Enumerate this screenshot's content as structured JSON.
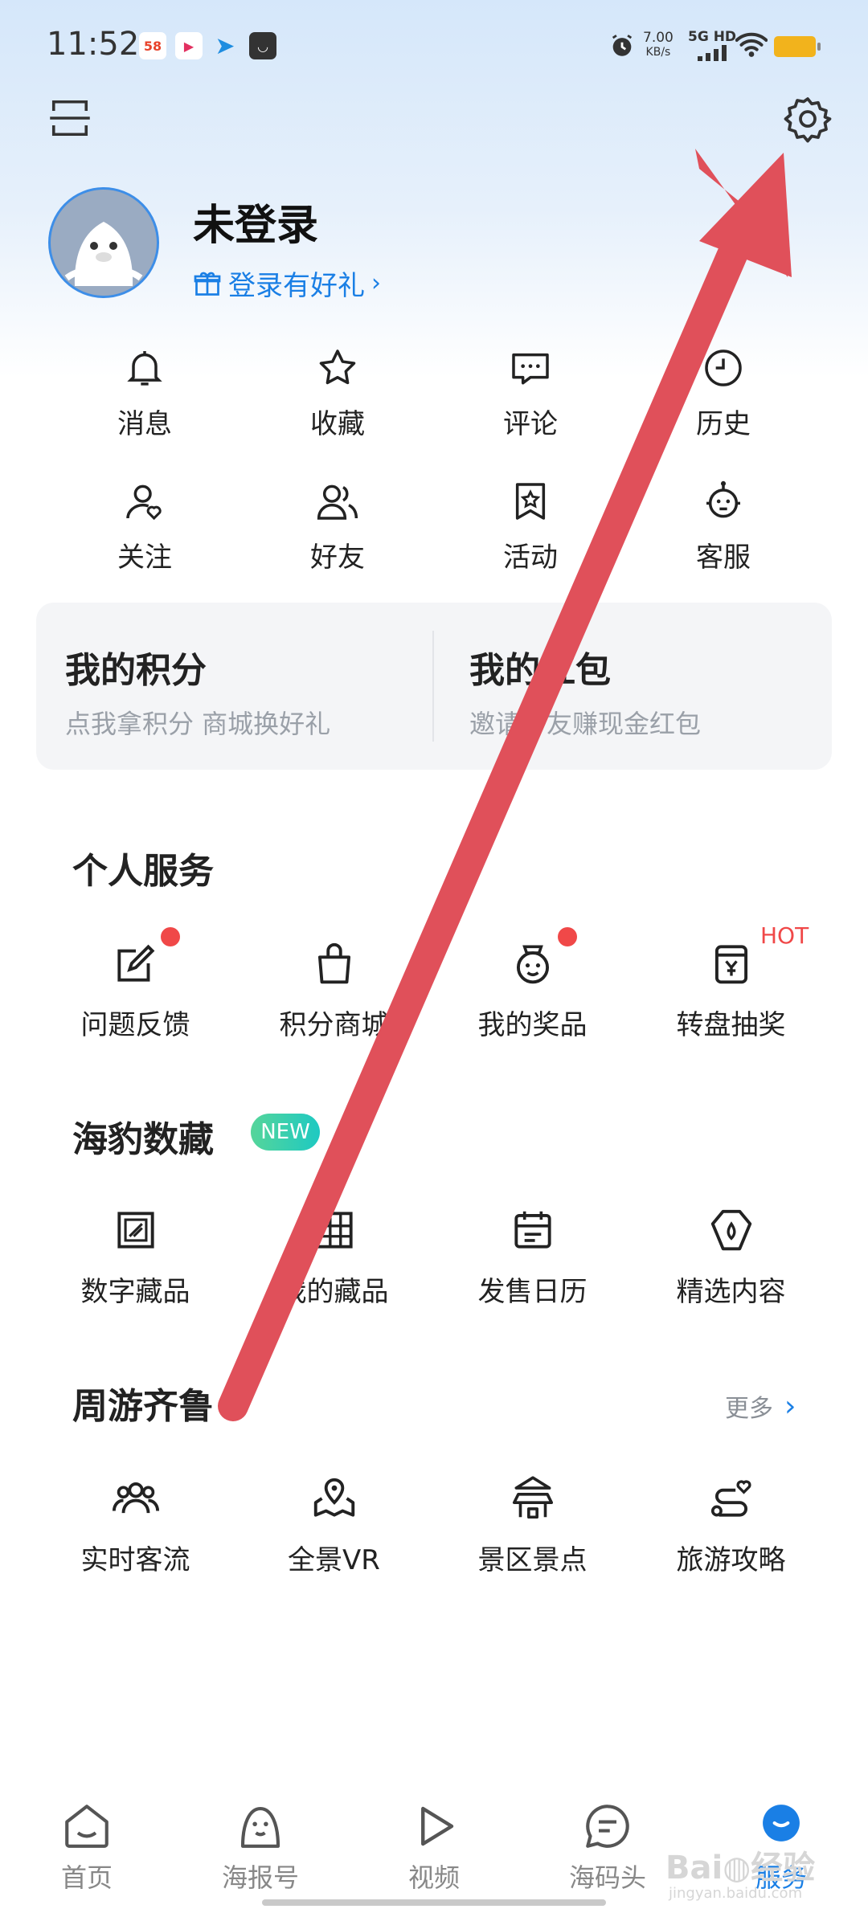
{
  "status_bar": {
    "time": "11:52",
    "speed_value": "7.00",
    "speed_unit": "KB/s",
    "network": "5G HD"
  },
  "profile": {
    "name": "未登录",
    "login_tip": "登录有好礼"
  },
  "quick_actions": [
    {
      "label": "消息",
      "icon": "bell-icon"
    },
    {
      "label": "收藏",
      "icon": "star-icon"
    },
    {
      "label": "评论",
      "icon": "comment-icon"
    },
    {
      "label": "历史",
      "icon": "clock-icon"
    },
    {
      "label": "关注",
      "icon": "follow-icon"
    },
    {
      "label": "好友",
      "icon": "friends-icon"
    },
    {
      "label": "活动",
      "icon": "activity-icon"
    },
    {
      "label": "客服",
      "icon": "service-icon"
    }
  ],
  "points_card": {
    "points_title": "我的积分",
    "points_sub": "点我拿积分 商城换好礼",
    "redpacket_title": "我的红包",
    "redpacket_sub": "邀请好友赚现金红包"
  },
  "personal_services": {
    "title": "个人服务",
    "items": [
      {
        "label": "问题反馈",
        "icon": "feedback-icon",
        "badge_dot": true
      },
      {
        "label": "积分商城",
        "icon": "shopping-bag-icon"
      },
      {
        "label": "我的奖品",
        "icon": "prize-icon",
        "badge_dot": true
      },
      {
        "label": "转盘抽奖",
        "icon": "lottery-icon",
        "badge_text": "HOT"
      }
    ]
  },
  "digital_collection": {
    "title": "海豹数藏",
    "badge": "NEW",
    "items": [
      {
        "label": "数字藏品",
        "icon": "digital-collection-icon"
      },
      {
        "label": "我的藏品",
        "icon": "my-collection-icon"
      },
      {
        "label": "发售日历",
        "icon": "calendar-icon"
      },
      {
        "label": "精选内容",
        "icon": "featured-icon"
      }
    ]
  },
  "travel": {
    "title": "周游齐鲁",
    "more": "更多",
    "items": [
      {
        "label": "实时客流",
        "icon": "crowd-icon"
      },
      {
        "label": "全景VR",
        "icon": "vr-map-icon"
      },
      {
        "label": "景区景点",
        "icon": "pavilion-icon"
      },
      {
        "label": "旅游攻略",
        "icon": "route-icon"
      }
    ]
  },
  "bottom_nav": [
    {
      "label": "首页",
      "icon": "home-icon"
    },
    {
      "label": "海报号",
      "icon": "seal-icon"
    },
    {
      "label": "视频",
      "icon": "play-icon"
    },
    {
      "label": "海码头",
      "icon": "chat-icon"
    },
    {
      "label": "服务",
      "icon": "service-tab-icon",
      "active": true
    }
  ],
  "colors": {
    "accent": "#1a7fe5",
    "arrow": "#e0505a",
    "badge_red": "#f04848"
  }
}
